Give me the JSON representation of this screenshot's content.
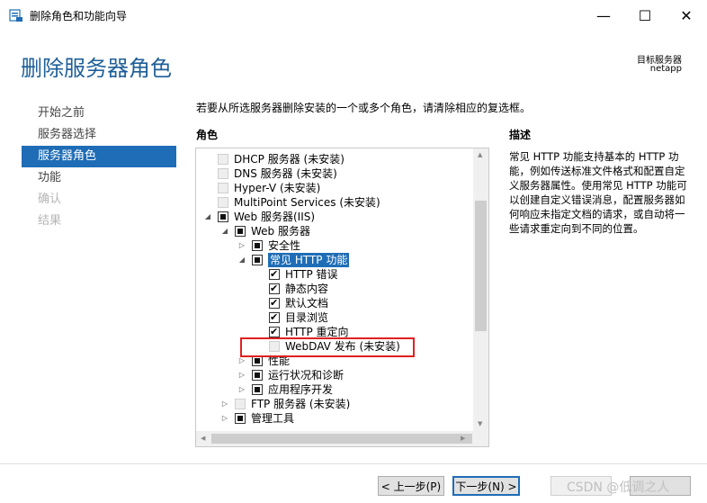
{
  "window": {
    "title": "删除角色和功能向导",
    "minimize_glyph": "—",
    "maximize_glyph": "☐",
    "close_glyph": "✕"
  },
  "header": {
    "page_title": "删除服务器角色",
    "target_label": "目标服务器",
    "target_name": "netapp"
  },
  "nav": {
    "items": [
      {
        "label": "开始之前",
        "state": "normal"
      },
      {
        "label": "服务器选择",
        "state": "normal"
      },
      {
        "label": "服务器角色",
        "state": "active"
      },
      {
        "label": "功能",
        "state": "normal"
      },
      {
        "label": "确认",
        "state": "disabled"
      },
      {
        "label": "结果",
        "state": "disabled"
      }
    ]
  },
  "main": {
    "instruction": "若要从所选服务器删除安装的一个或多个角色，请清除相应的复选框。",
    "roles_label": "角色",
    "description_label": "描述",
    "description_text": "常见 HTTP 功能支持基本的 HTTP 功能，例如传送标准文件格式和配置自定义服务器属性。使用常见 HTTP 功能可以创建自定义错误消息，配置服务器如何响应未指定文档的请求，或自动将一些请求重定向到不同的位置。"
  },
  "tree": {
    "rows": [
      {
        "label": "DHCP 服务器 (未安装)",
        "indent": 0,
        "expander": "",
        "check": "gray"
      },
      {
        "label": "DNS 服务器 (未安装)",
        "indent": 0,
        "expander": "",
        "check": "gray"
      },
      {
        "label": "Hyper-V (未安装)",
        "indent": 0,
        "expander": "",
        "check": "gray"
      },
      {
        "label": "MultiPoint Services (未安装)",
        "indent": 0,
        "expander": "",
        "check": "gray"
      },
      {
        "label": "Web 服务器(IIS)",
        "indent": 0,
        "expander": "open",
        "check": "partial"
      },
      {
        "label": "Web 服务器",
        "indent": 1,
        "expander": "open",
        "check": "partial"
      },
      {
        "label": "安全性",
        "indent": 2,
        "expander": "closed",
        "check": "partial"
      },
      {
        "label": "常见 HTTP 功能",
        "indent": 2,
        "expander": "open",
        "check": "partial",
        "selected": true
      },
      {
        "label": "HTTP 错误",
        "indent": 3,
        "expander": "",
        "check": "checked"
      },
      {
        "label": "静态内容",
        "indent": 3,
        "expander": "",
        "check": "checked"
      },
      {
        "label": "默认文档",
        "indent": 3,
        "expander": "",
        "check": "checked"
      },
      {
        "label": "目录浏览",
        "indent": 3,
        "expander": "",
        "check": "checked"
      },
      {
        "label": "HTTP 重定向",
        "indent": 3,
        "expander": "",
        "check": "checked"
      },
      {
        "label": "WebDAV 发布 (未安装)",
        "indent": 3,
        "expander": "",
        "check": "gray"
      },
      {
        "label": "性能",
        "indent": 2,
        "expander": "closed",
        "check": "partial"
      },
      {
        "label": "运行状况和诊断",
        "indent": 2,
        "expander": "closed",
        "check": "partial"
      },
      {
        "label": "应用程序开发",
        "indent": 2,
        "expander": "closed",
        "check": "partial"
      },
      {
        "label": "FTP 服务器 (未安装)",
        "indent": 1,
        "expander": "closed",
        "check": "gray"
      },
      {
        "label": "管理工具",
        "indent": 1,
        "expander": "closed",
        "check": "partial"
      }
    ]
  },
  "footer": {
    "prev_label": "< 上一步(P)",
    "next_label": "下一步(N) >",
    "watermark": "CSDN @低调之人"
  }
}
